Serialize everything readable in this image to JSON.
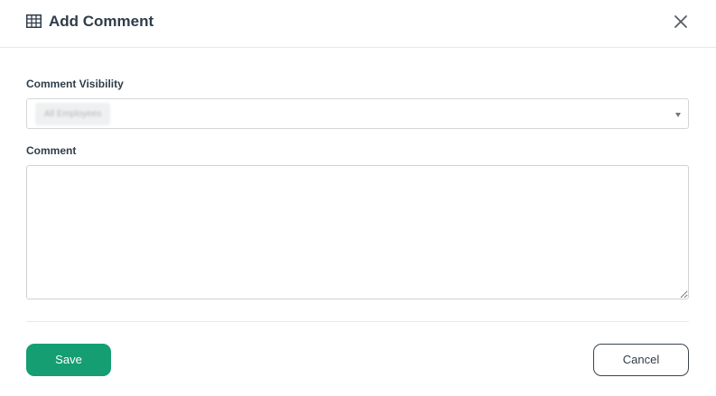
{
  "dialog": {
    "title": "Add Comment",
    "title_icon": "table-icon",
    "close_icon": "close-icon"
  },
  "form": {
    "visibility": {
      "label": "Comment Visibility",
      "selected": "All Employees"
    },
    "comment": {
      "label": "Comment",
      "value": ""
    }
  },
  "actions": {
    "save_label": "Save",
    "cancel_label": "Cancel"
  },
  "colors": {
    "save_button": "#149e72",
    "title_text": "#2f3d4a"
  }
}
